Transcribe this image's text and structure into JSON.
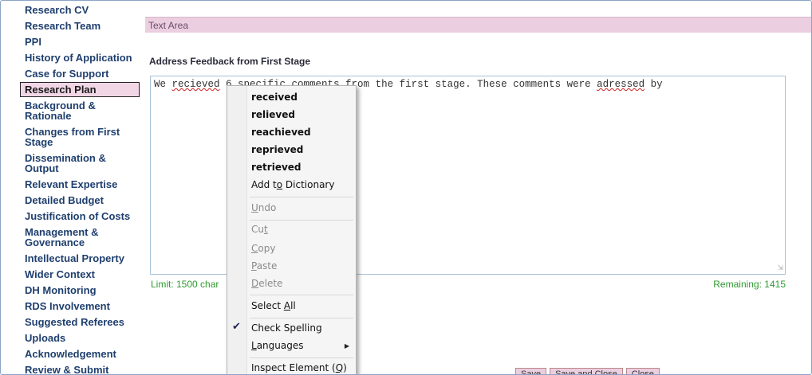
{
  "sidebar": {
    "items": [
      {
        "label": "Research CV"
      },
      {
        "label": "Research Team"
      },
      {
        "label": "PPI"
      },
      {
        "label": "History of Application"
      },
      {
        "label": "Case for Support"
      },
      {
        "label": "Research Plan"
      },
      {
        "label": "Background & Rationale"
      },
      {
        "label": "Changes from First Stage"
      },
      {
        "label": "Dissemination & Output"
      },
      {
        "label": "Relevant Expertise"
      },
      {
        "label": "Detailed Budget"
      },
      {
        "label": "Justification of Costs"
      },
      {
        "label": "Management & Governance"
      },
      {
        "label": "Intellectual Property"
      },
      {
        "label": "Wider Context"
      },
      {
        "label": "DH Monitoring"
      },
      {
        "label": "RDS Involvement"
      },
      {
        "label": "Suggested Referees"
      },
      {
        "label": "Uploads"
      },
      {
        "label": "Acknowledgement"
      },
      {
        "label": "Review & Submit"
      }
    ],
    "active": "Research Plan"
  },
  "panel": {
    "header": "Text Area",
    "field_label": "Address Feedback from First Stage",
    "text_before": "We ",
    "text_word1": "recieved",
    "text_middle": " 6 specific comments from the first stage. These comments were ",
    "text_word2": "adressed",
    "text_after": " by",
    "limit": "Limit: 1500 char",
    "remaining": "Remaining: 1415"
  },
  "context_menu": {
    "suggestions": [
      "received",
      "relieved",
      "reachieved",
      "reprieved",
      "retrieved"
    ],
    "add_to_dictionary": {
      "pre": "Add t",
      "key": "o",
      "post": " Dictionary"
    },
    "undo": {
      "key": "U",
      "post": "ndo"
    },
    "cut": {
      "pre": "Cu",
      "key": "t",
      "post": ""
    },
    "copy": {
      "key": "C",
      "post": "opy"
    },
    "paste": {
      "key": "P",
      "post": "aste"
    },
    "delete": {
      "key": "D",
      "post": "elete"
    },
    "select_all": {
      "pre": "Select ",
      "key": "A",
      "post": "ll"
    },
    "check_spelling": "Check Spelling",
    "check_spelling_checked": true,
    "languages": {
      "key": "L",
      "post": "anguages"
    },
    "inspect": {
      "pre": "Inspect Element (",
      "key": "Q",
      "post": ")"
    }
  },
  "bottom_buttons": [
    "Save",
    "Save and Close",
    "Close"
  ],
  "colors": {
    "accent_pink": "#ebcfe0",
    "nav_text": "#1f3f6e",
    "limit_green": "#2e9a2e",
    "spell_error": "#d02020"
  },
  "icons": {
    "check": "checkmark-icon",
    "submenu": "triangle-right-icon",
    "resize": "resize-grip-icon"
  }
}
